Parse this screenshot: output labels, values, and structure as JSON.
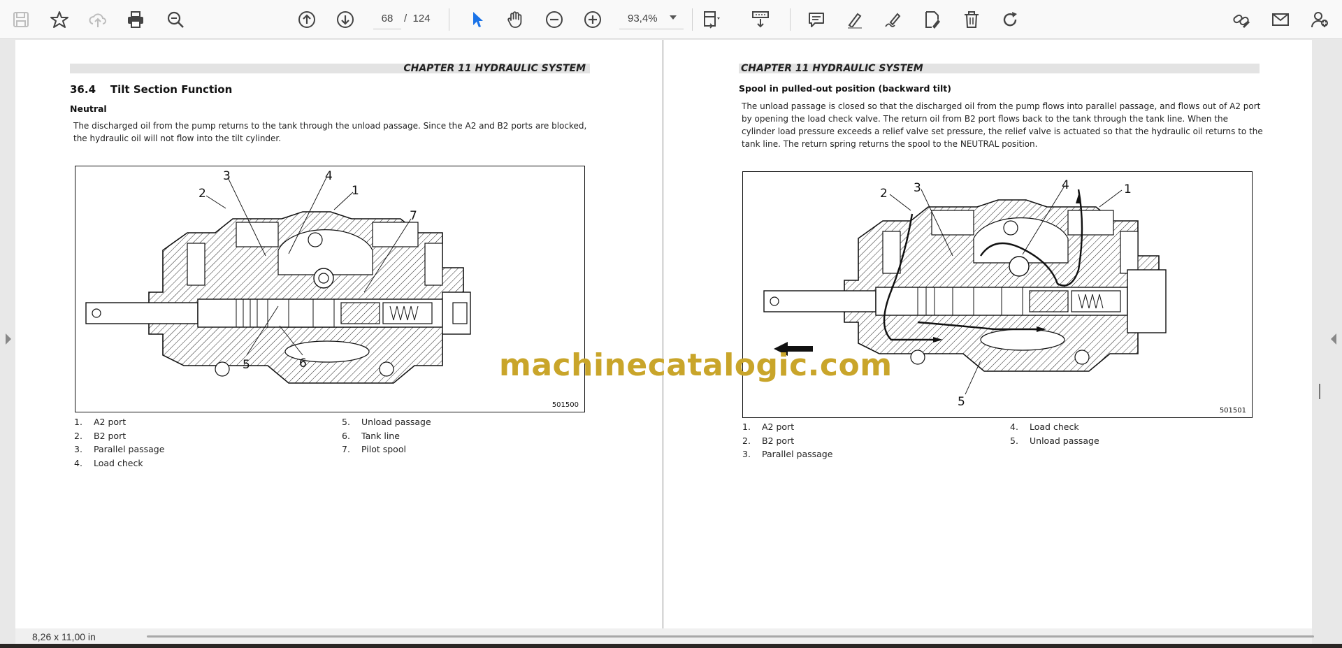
{
  "toolbar": {
    "page_current": "68",
    "page_separator": "/",
    "page_total": "124",
    "zoom": "93,4%",
    "icons": [
      "save-icon",
      "bookmark-star-icon",
      "cloud-upload-icon",
      "print-icon",
      "zoom-search-icon",
      "page-up-icon",
      "page-down-icon",
      "select-cursor-icon",
      "hand-tool-icon",
      "zoom-out-icon",
      "zoom-in-icon",
      "page-fit-icon",
      "scroll-mode-icon",
      "comment-icon",
      "highlight-pen-icon",
      "draw-sign-icon",
      "edit-document-icon",
      "delete-icon",
      "rotate-icon",
      "share-link-icon",
      "email-icon",
      "account-icon"
    ],
    "accent_color": "#1a73e8"
  },
  "left_page": {
    "chapter": "CHAPTER 11 HYDRAULIC SYSTEM",
    "section_number": "36.4",
    "section_title": "Tilt Section Function",
    "subheading": "Neutral",
    "paragraph": "The discharged oil from the pump returns to the tank through the unload passage. Since the A2 and B2 ports are blocked, the hydraulic oil will not flow into the tilt cylinder.",
    "figure_code": "501500",
    "callouts": [
      "1",
      "2",
      "3",
      "4",
      "5",
      "6",
      "7"
    ],
    "legend_col1": [
      {
        "num": "1.",
        "label": "A2 port"
      },
      {
        "num": "2.",
        "label": "B2 port"
      },
      {
        "num": "3.",
        "label": "Parallel passage"
      },
      {
        "num": "4.",
        "label": "Load check"
      }
    ],
    "legend_col2": [
      {
        "num": "5.",
        "label": "Unload passage"
      },
      {
        "num": "6.",
        "label": "Tank line"
      },
      {
        "num": "7.",
        "label": "Pilot spool"
      }
    ]
  },
  "right_page": {
    "chapter": "CHAPTER 11 HYDRAULIC SYSTEM",
    "subheading": "Spool in pulled-out position (backward tilt)",
    "paragraph": "The unload passage is closed so that the discharged oil from the pump flows into parallel passage, and flows out of A2 port by opening the load check valve. The return oil from B2 port flows back to the tank through the tank line. When the cylinder load pressure exceeds a relief valve set pressure, the relief valve is actuated so that the hydraulic oil returns to the tank line. The return spring returns the spool to the NEUTRAL position.",
    "figure_code": "501501",
    "callouts": [
      "1",
      "2",
      "3",
      "4",
      "5"
    ],
    "legend_col1": [
      {
        "num": "1.",
        "label": "A2 port"
      },
      {
        "num": "2.",
        "label": "B2 port"
      },
      {
        "num": "3.",
        "label": "Parallel passage"
      }
    ],
    "legend_col2": [
      {
        "num": "4.",
        "label": "Load check"
      },
      {
        "num": "5.",
        "label": "Unload passage"
      }
    ]
  },
  "watermark": "machinecatalogic.com",
  "status": {
    "page_size": "8,26 x 11,00 in"
  }
}
